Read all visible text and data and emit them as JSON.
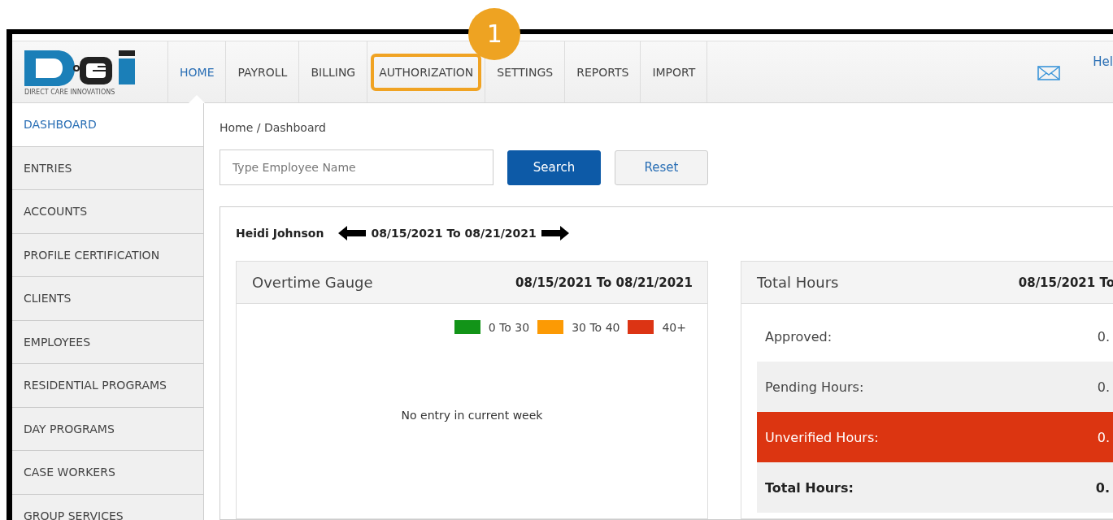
{
  "logo": {
    "tagline": "DIRECT CARE INNOVATIONS"
  },
  "nav": [
    {
      "label": "HOME",
      "selected": true,
      "highlighted": false
    },
    {
      "label": "PAYROLL",
      "selected": false,
      "highlighted": false
    },
    {
      "label": "BILLING",
      "selected": false,
      "highlighted": false
    },
    {
      "label": "AUTHORIZATION",
      "selected": false,
      "highlighted": true
    },
    {
      "label": "SETTINGS",
      "selected": false,
      "highlighted": false
    },
    {
      "label": "REPORTS",
      "selected": false,
      "highlighted": false
    },
    {
      "label": "IMPORT",
      "selected": false,
      "highlighted": false
    }
  ],
  "help_link": "Hel",
  "callout": {
    "number": "1"
  },
  "sidebar": {
    "items": [
      {
        "label": "DASHBOARD",
        "selected": true
      },
      {
        "label": "ENTRIES",
        "selected": false
      },
      {
        "label": "ACCOUNTS",
        "selected": false
      },
      {
        "label": "PROFILE CERTIFICATION",
        "selected": false
      },
      {
        "label": "CLIENTS",
        "selected": false
      },
      {
        "label": "EMPLOYEES",
        "selected": false
      },
      {
        "label": "RESIDENTIAL PROGRAMS",
        "selected": false
      },
      {
        "label": "DAY PROGRAMS",
        "selected": false
      },
      {
        "label": "CASE WORKERS",
        "selected": false
      },
      {
        "label": "GROUP SERVICES",
        "selected": false
      }
    ]
  },
  "breadcrumb": "Home / Dashboard",
  "search": {
    "placeholder": "Type Employee Name",
    "search_button": "Search",
    "reset_button": "Reset"
  },
  "week": {
    "employee": "Heidi Johnson",
    "range": "08/15/2021 To 08/21/2021"
  },
  "overtime_gauge": {
    "title": "Overtime Gauge",
    "range": "08/15/2021 To 08/21/2021",
    "legend": [
      {
        "label": "0 To 30",
        "color": "#129418"
      },
      {
        "label": "30 To 40",
        "color": "#fc9a04"
      },
      {
        "label": "40+",
        "color": "#dc3414"
      }
    ],
    "empty_message": "No entry in current week"
  },
  "total_hours": {
    "title": "Total Hours",
    "range": "08/15/2021 To",
    "rows": [
      {
        "label": "Approved:",
        "value": "0.",
        "kind": "plain"
      },
      {
        "label": "Pending Hours:",
        "value": "0.",
        "kind": "shaded"
      },
      {
        "label": "Unverified Hours:",
        "value": "0.",
        "kind": "alert"
      },
      {
        "label": "Total Hours:",
        "value": "0.",
        "kind": "total"
      }
    ]
  }
}
